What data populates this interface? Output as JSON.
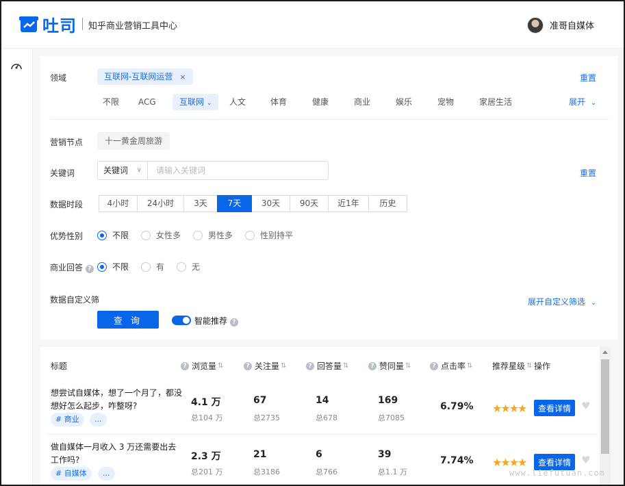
{
  "header": {
    "logo_text": "吐司",
    "subtitle": "知乎商业营销工具中心",
    "user_name": "准哥自媒体"
  },
  "filters": {
    "domain_label": "领域",
    "selected_tag": "互联网-互联网运营",
    "reset_label": "重置",
    "categories": [
      "不限",
      "ACG",
      "互联网",
      "人文",
      "体育",
      "健康",
      "商业",
      "娱乐",
      "宠物",
      "家居生活"
    ],
    "active_category": "互联网",
    "expand_label": "展开",
    "node_label": "营销节点",
    "node_chip": "十一黄金周旅游",
    "keyword_label": "关键词",
    "keyword_type": "关键词",
    "keyword_placeholder": "请输入关键词",
    "keyword_reset": "重置",
    "period_label": "数据时段",
    "periods": [
      "4小时",
      "24小时",
      "3天",
      "7天",
      "30天",
      "90天",
      "近1年",
      "历史"
    ],
    "active_period": "7天",
    "gender_label": "优势性别",
    "gender_options": [
      "不限",
      "女性多",
      "男性多",
      "性别持平"
    ],
    "gender_selected": "不限",
    "biz_label": "商业回答",
    "biz_options": [
      "不限",
      "有",
      "无"
    ],
    "biz_selected": "不限",
    "custom_label": "数据自定义筛",
    "custom_expand": "展开自定义筛选",
    "query_button": "查 询",
    "smart_label": "智能推荐"
  },
  "table": {
    "columns": [
      "标题",
      "浏览量",
      "关注量",
      "回答量",
      "赞同量",
      "点击率",
      "推荐星级",
      "操作"
    ],
    "rows": [
      {
        "title": "想尝试自媒体，想了一个月了，都没想好怎么起步，咋整呀?",
        "tag": "# 商业",
        "more": "...",
        "views": "4.1 万",
        "views_total": "总104 万",
        "follows": "67",
        "follows_total": "总2735",
        "answers": "14",
        "answers_total": "总678",
        "likes": "169",
        "likes_total": "总7085",
        "ctr": "6.79%",
        "stars": "★★★★",
        "action": "查看详情"
      },
      {
        "title": "做自媒体一月收入 3 万还需要出去工作吗?",
        "tag": "# 自媒体",
        "more": "...",
        "views": "2.3 万",
        "views_total": "总201 万",
        "follows": "21",
        "follows_total": "总3186",
        "answers": "6",
        "answers_total": "总766",
        "likes": "39",
        "likes_total": "总1.1 万",
        "ctr": "7.74%",
        "stars": "★★★★",
        "action": "查看详情"
      }
    ]
  },
  "watermark": "www.liefutuan.com",
  "colors": {
    "accent": "#0a66e8",
    "star": "#f5a623"
  }
}
